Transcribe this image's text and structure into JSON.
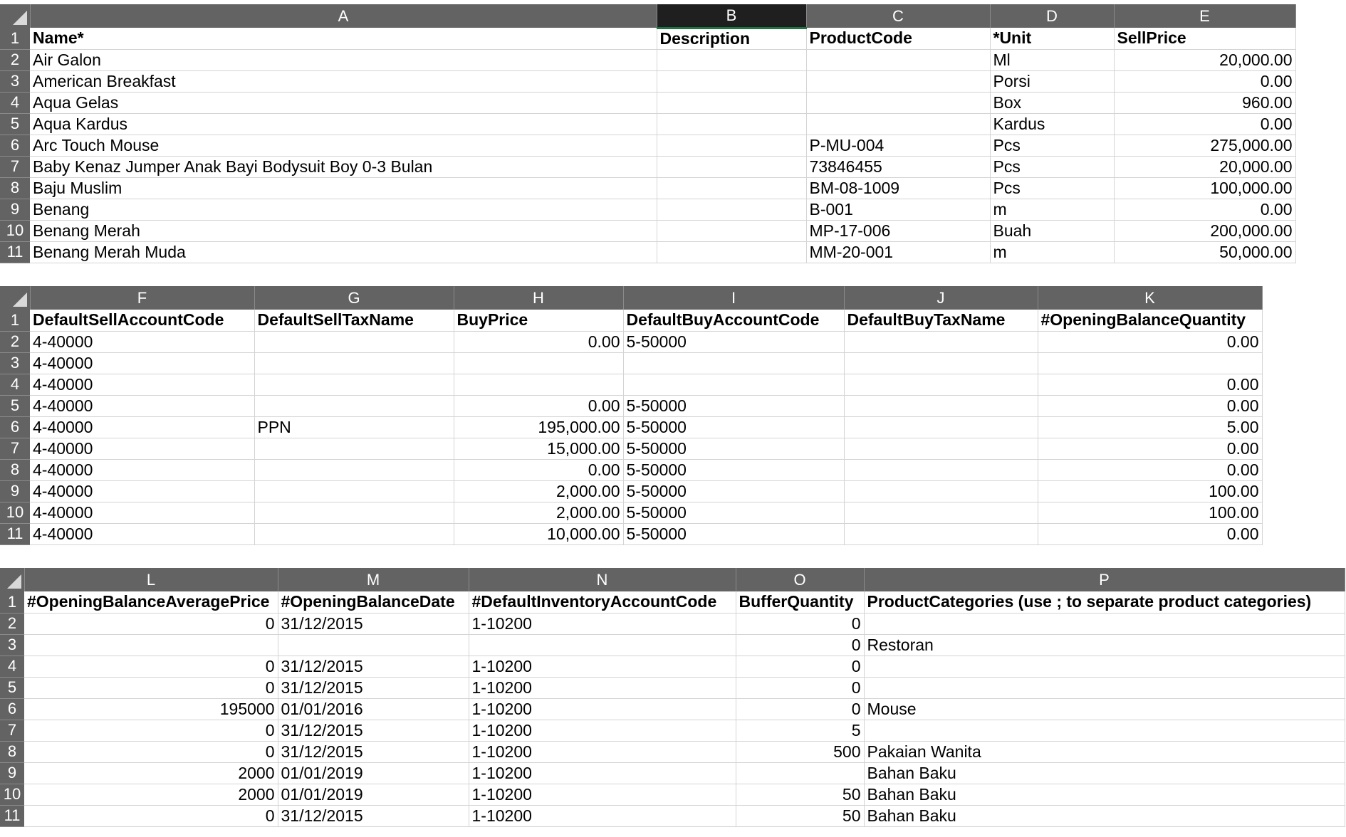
{
  "sheet1": {
    "columns": [
      "A",
      "B",
      "C",
      "D",
      "E"
    ],
    "selected_column": "B",
    "rows": [
      {
        "n": "1",
        "cells": [
          "Name*",
          "Description",
          "ProductCode",
          "*Unit",
          "SellPrice"
        ]
      },
      {
        "n": "2",
        "cells": [
          "Air Galon",
          "",
          "",
          "Ml",
          "20,000.00"
        ]
      },
      {
        "n": "3",
        "cells": [
          "American Breakfast",
          "",
          "",
          "Porsi",
          "0.00"
        ]
      },
      {
        "n": "4",
        "cells": [
          "Aqua Gelas",
          "",
          "",
          "Box",
          "960.00"
        ]
      },
      {
        "n": "5",
        "cells": [
          "Aqua Kardus",
          "",
          "",
          "Kardus",
          "0.00"
        ]
      },
      {
        "n": "6",
        "cells": [
          "Arc Touch Mouse",
          "",
          "P-MU-004",
          "Pcs",
          "275,000.00"
        ]
      },
      {
        "n": "7",
        "cells": [
          "Baby Kenaz Jumper Anak Bayi Bodysuit Boy 0-3 Bulan",
          "",
          "73846455",
          "Pcs",
          "20,000.00"
        ]
      },
      {
        "n": "8",
        "cells": [
          "Baju Muslim",
          "",
          "BM-08-1009",
          "Pcs",
          "100,000.00"
        ]
      },
      {
        "n": "9",
        "cells": [
          "Benang",
          "",
          "B-001",
          "m",
          "0.00"
        ]
      },
      {
        "n": "10",
        "cells": [
          "Benang Merah",
          "",
          "MP-17-006",
          "Buah",
          "200,000.00"
        ]
      },
      {
        "n": "11",
        "cells": [
          "Benang Merah Muda",
          "",
          "MM-20-001",
          "m",
          "50,000.00"
        ]
      }
    ]
  },
  "sheet2": {
    "columns": [
      "F",
      "G",
      "H",
      "I",
      "J",
      "K"
    ],
    "rows": [
      {
        "n": "1",
        "cells": [
          "DefaultSellAccountCode",
          "DefaultSellTaxName",
          "BuyPrice",
          "DefaultBuyAccountCode",
          "DefaultBuyTaxName",
          "#OpeningBalanceQuantity"
        ]
      },
      {
        "n": "2",
        "cells": [
          "4-40000",
          "",
          "0.00",
          "5-50000",
          "",
          "0.00"
        ]
      },
      {
        "n": "3",
        "cells": [
          "4-40000",
          "",
          "",
          "",
          "",
          ""
        ]
      },
      {
        "n": "4",
        "cells": [
          "4-40000",
          "",
          "",
          "",
          "",
          "0.00"
        ]
      },
      {
        "n": "5",
        "cells": [
          "4-40000",
          "",
          "0.00",
          "5-50000",
          "",
          "0.00"
        ]
      },
      {
        "n": "6",
        "cells": [
          "4-40000",
          "PPN",
          "195,000.00",
          "5-50000",
          "",
          "5.00"
        ]
      },
      {
        "n": "7",
        "cells": [
          "4-40000",
          "",
          "15,000.00",
          "5-50000",
          "",
          "0.00"
        ]
      },
      {
        "n": "8",
        "cells": [
          "4-40000",
          "",
          "0.00",
          "5-50000",
          "",
          "0.00"
        ]
      },
      {
        "n": "9",
        "cells": [
          "4-40000",
          "",
          "2,000.00",
          "5-50000",
          "",
          "100.00"
        ]
      },
      {
        "n": "10",
        "cells": [
          "4-40000",
          "",
          "2,000.00",
          "5-50000",
          "",
          "100.00"
        ]
      },
      {
        "n": "11",
        "cells": [
          "4-40000",
          "",
          "10,000.00",
          "5-50000",
          "",
          "0.00"
        ]
      }
    ]
  },
  "sheet3": {
    "columns": [
      "L",
      "M",
      "N",
      "O",
      "P"
    ],
    "rows": [
      {
        "n": "1",
        "cells": [
          "#OpeningBalanceAveragePrice",
          "#OpeningBalanceDate",
          "#DefaultInventoryAccountCode",
          "BufferQuantity",
          "ProductCategories (use ; to separate product categories)"
        ]
      },
      {
        "n": "2",
        "cells": [
          "0",
          "31/12/2015",
          "1-10200",
          "0",
          ""
        ]
      },
      {
        "n": "3",
        "cells": [
          "",
          "",
          "",
          "0",
          "Restoran"
        ]
      },
      {
        "n": "4",
        "cells": [
          "0",
          "31/12/2015",
          "1-10200",
          "0",
          ""
        ]
      },
      {
        "n": "5",
        "cells": [
          "0",
          "31/12/2015",
          "1-10200",
          "0",
          ""
        ]
      },
      {
        "n": "6",
        "cells": [
          "195000",
          "01/01/2016",
          "1-10200",
          "0",
          "Mouse"
        ]
      },
      {
        "n": "7",
        "cells": [
          "0",
          "31/12/2015",
          "1-10200",
          "5",
          ""
        ]
      },
      {
        "n": "8",
        "cells": [
          "0",
          "31/12/2015",
          "1-10200",
          "500",
          "Pakaian Wanita"
        ]
      },
      {
        "n": "9",
        "cells": [
          "2000",
          "01/01/2019",
          "1-10200",
          "",
          "Bahan Baku"
        ]
      },
      {
        "n": "10",
        "cells": [
          "2000",
          "01/01/2019",
          "1-10200",
          "50",
          "Bahan Baku"
        ]
      },
      {
        "n": "11",
        "cells": [
          "0",
          "31/12/2015",
          "1-10200",
          "50",
          "Bahan Baku"
        ]
      }
    ]
  }
}
